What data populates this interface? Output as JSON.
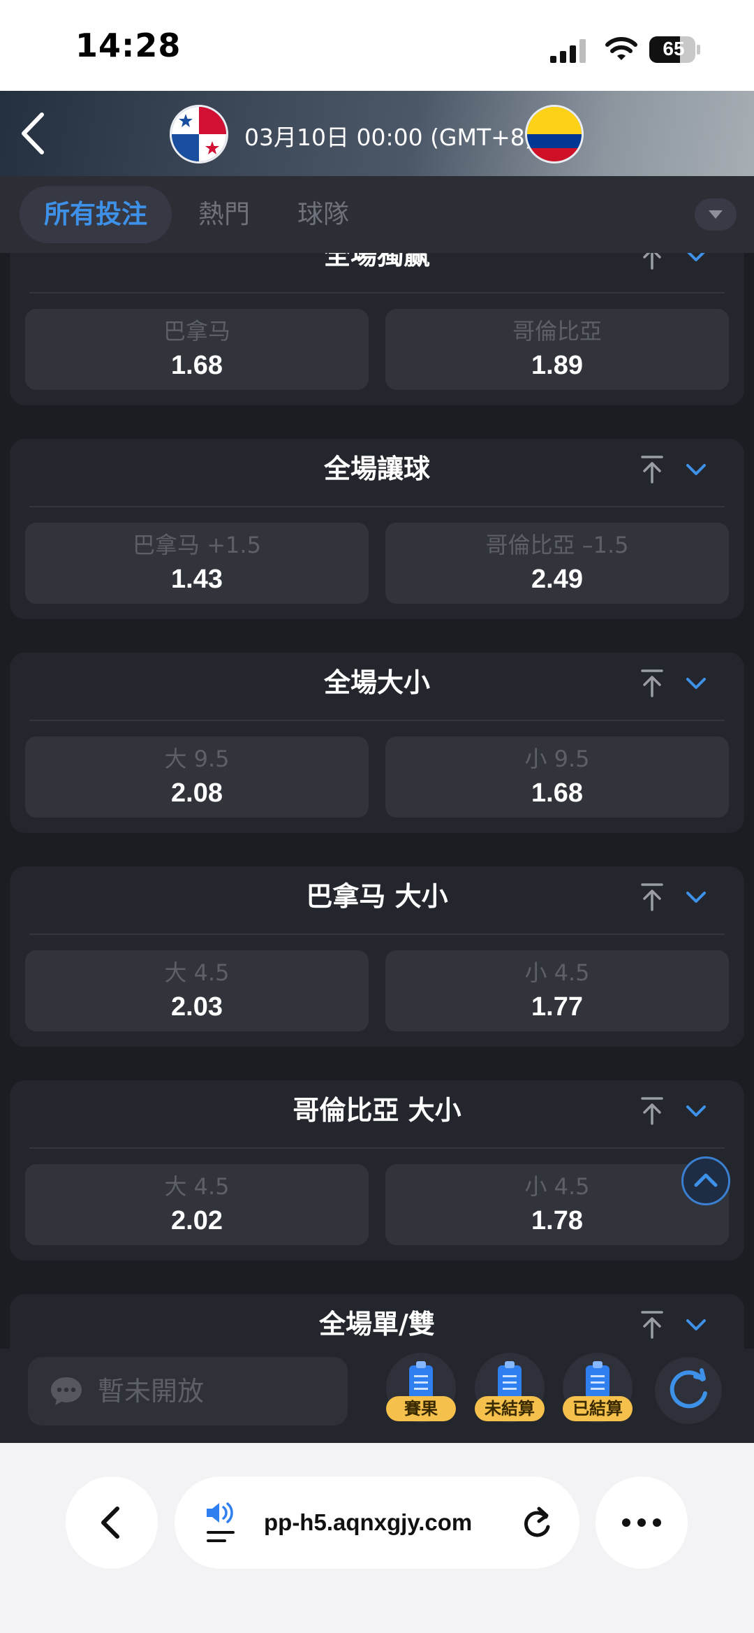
{
  "status_bar": {
    "time": "14:28",
    "battery": "65"
  },
  "header": {
    "match_time": "03月10日 00:00 (GMT+8)"
  },
  "tabs": [
    {
      "label": "所有投注",
      "active": true
    },
    {
      "label": "熱門",
      "active": false
    },
    {
      "label": "球隊",
      "active": false
    }
  ],
  "markets": [
    {
      "title": "全場獨赢",
      "options": [
        {
          "label": "巴拿马",
          "odds": "1.68"
        },
        {
          "label": "哥倫比亞",
          "odds": "1.89"
        }
      ]
    },
    {
      "title": "全場讓球",
      "options": [
        {
          "label": "巴拿马 +1.5",
          "odds": "1.43"
        },
        {
          "label": "哥倫比亞 –1.5",
          "odds": "2.49"
        }
      ]
    },
    {
      "title": "全場大小",
      "options": [
        {
          "label": "大 9.5",
          "odds": "2.08"
        },
        {
          "label": "小 9.5",
          "odds": "1.68"
        }
      ]
    },
    {
      "title": "巴拿马 大小",
      "options": [
        {
          "label": "大 4.5",
          "odds": "2.03"
        },
        {
          "label": "小 4.5",
          "odds": "1.77"
        }
      ]
    },
    {
      "title": "哥倫比亞 大小",
      "options": [
        {
          "label": "大 4.5",
          "odds": "2.02"
        },
        {
          "label": "小 4.5",
          "odds": "1.78"
        }
      ]
    },
    {
      "title": "全場單/雙"
    }
  ],
  "action_bar": {
    "chat_placeholder": "暫未開放",
    "tickets": [
      "賽果",
      "未結算",
      "已結算"
    ]
  },
  "browser": {
    "url": "pp-h5.aqnxgjy.com"
  },
  "colors": {
    "accent": "#3e91e8",
    "ticket_badge": "#f5c04b",
    "background": "#1c1d22",
    "card": "#24262d"
  }
}
